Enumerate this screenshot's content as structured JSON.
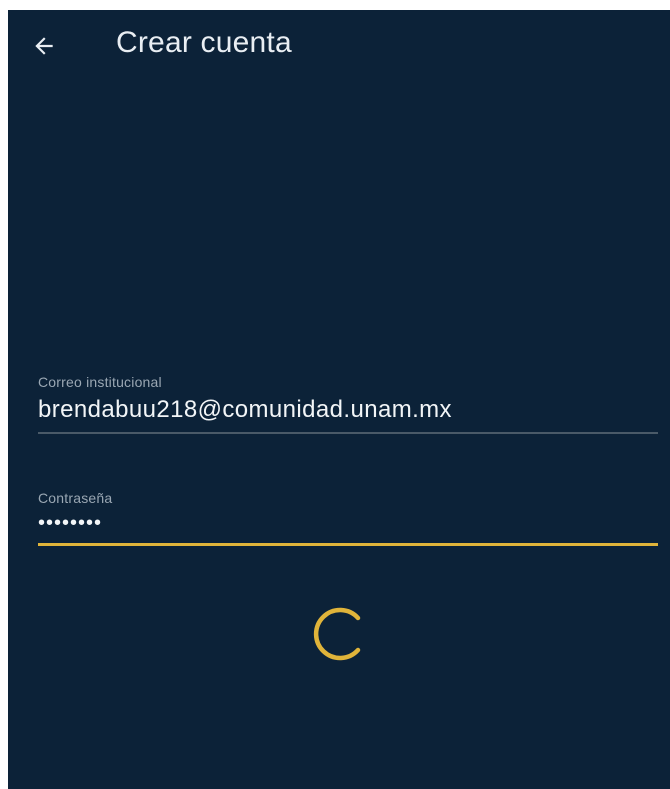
{
  "header": {
    "title": "Crear cuenta",
    "back_icon": "arrow-left-icon"
  },
  "form": {
    "email": {
      "label": "Correo institucional",
      "value": "brendabuu218@comunidad.unam.mx"
    },
    "password": {
      "label": "Contraseña",
      "value": "••••••••",
      "focused": true
    }
  },
  "loading": {
    "icon": "loading-spinner-icon",
    "active": true
  },
  "colors": {
    "background": "#0c2238",
    "accent": "#e0b43a",
    "text": "#f2f5f7",
    "label": "#9aa7b3",
    "divider": "#4a5a68"
  }
}
